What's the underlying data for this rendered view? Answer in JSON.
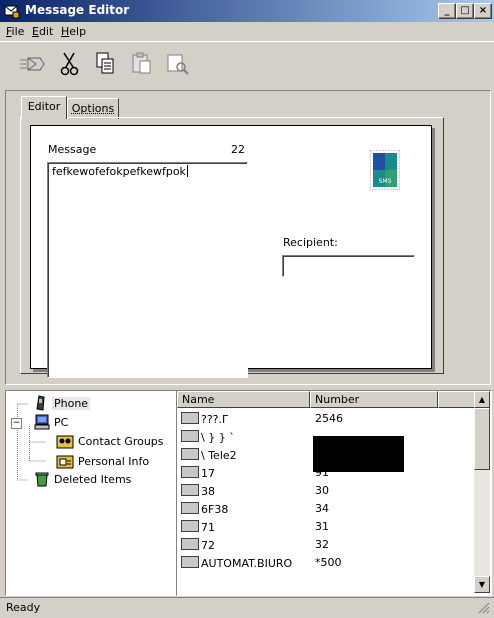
{
  "window": {
    "title": "Message Editor"
  },
  "menu": [
    {
      "key": "F",
      "rest": "ile"
    },
    {
      "key": "E",
      "rest": "dit"
    },
    {
      "key": "H",
      "rest": "elp"
    }
  ],
  "toolbar": {
    "buttons": [
      {
        "icon": "send-icon"
      },
      {
        "icon": "cut-icon"
      },
      {
        "icon": "copy-icon"
      },
      {
        "icon": "paste-icon"
      },
      {
        "icon": "find-icon"
      }
    ]
  },
  "tabs": {
    "editor": "Editor",
    "options": "Options"
  },
  "editor": {
    "message_label": "Message",
    "char_count": "22",
    "message_text": "fefkewofefokpefkewfpok",
    "recipient_label": "Recipient:",
    "recipient_value": "",
    "sms_icon_text": "SMS"
  },
  "tree": {
    "phone": "Phone",
    "pc": "PC",
    "contact_groups": "Contact Groups",
    "personal_info": "Personal Info",
    "deleted_items": "Deleted Items"
  },
  "list": {
    "headers": {
      "name": "Name",
      "number": "Number"
    },
    "rows": [
      {
        "name": "???.Г",
        "number": "2546"
      },
      {
        "name": "\\ } } `",
        "number": ""
      },
      {
        "name": "\\ Tele2",
        "number": ""
      },
      {
        "name": "17",
        "number": "91"
      },
      {
        "name": "38",
        "number": "30"
      },
      {
        "name": "6F38",
        "number": "34"
      },
      {
        "name": "71",
        "number": "31"
      },
      {
        "name": "72",
        "number": "32"
      },
      {
        "name": "AUTOMAT.BIURO",
        "number": "*500"
      }
    ]
  },
  "status": {
    "text": "Ready"
  }
}
